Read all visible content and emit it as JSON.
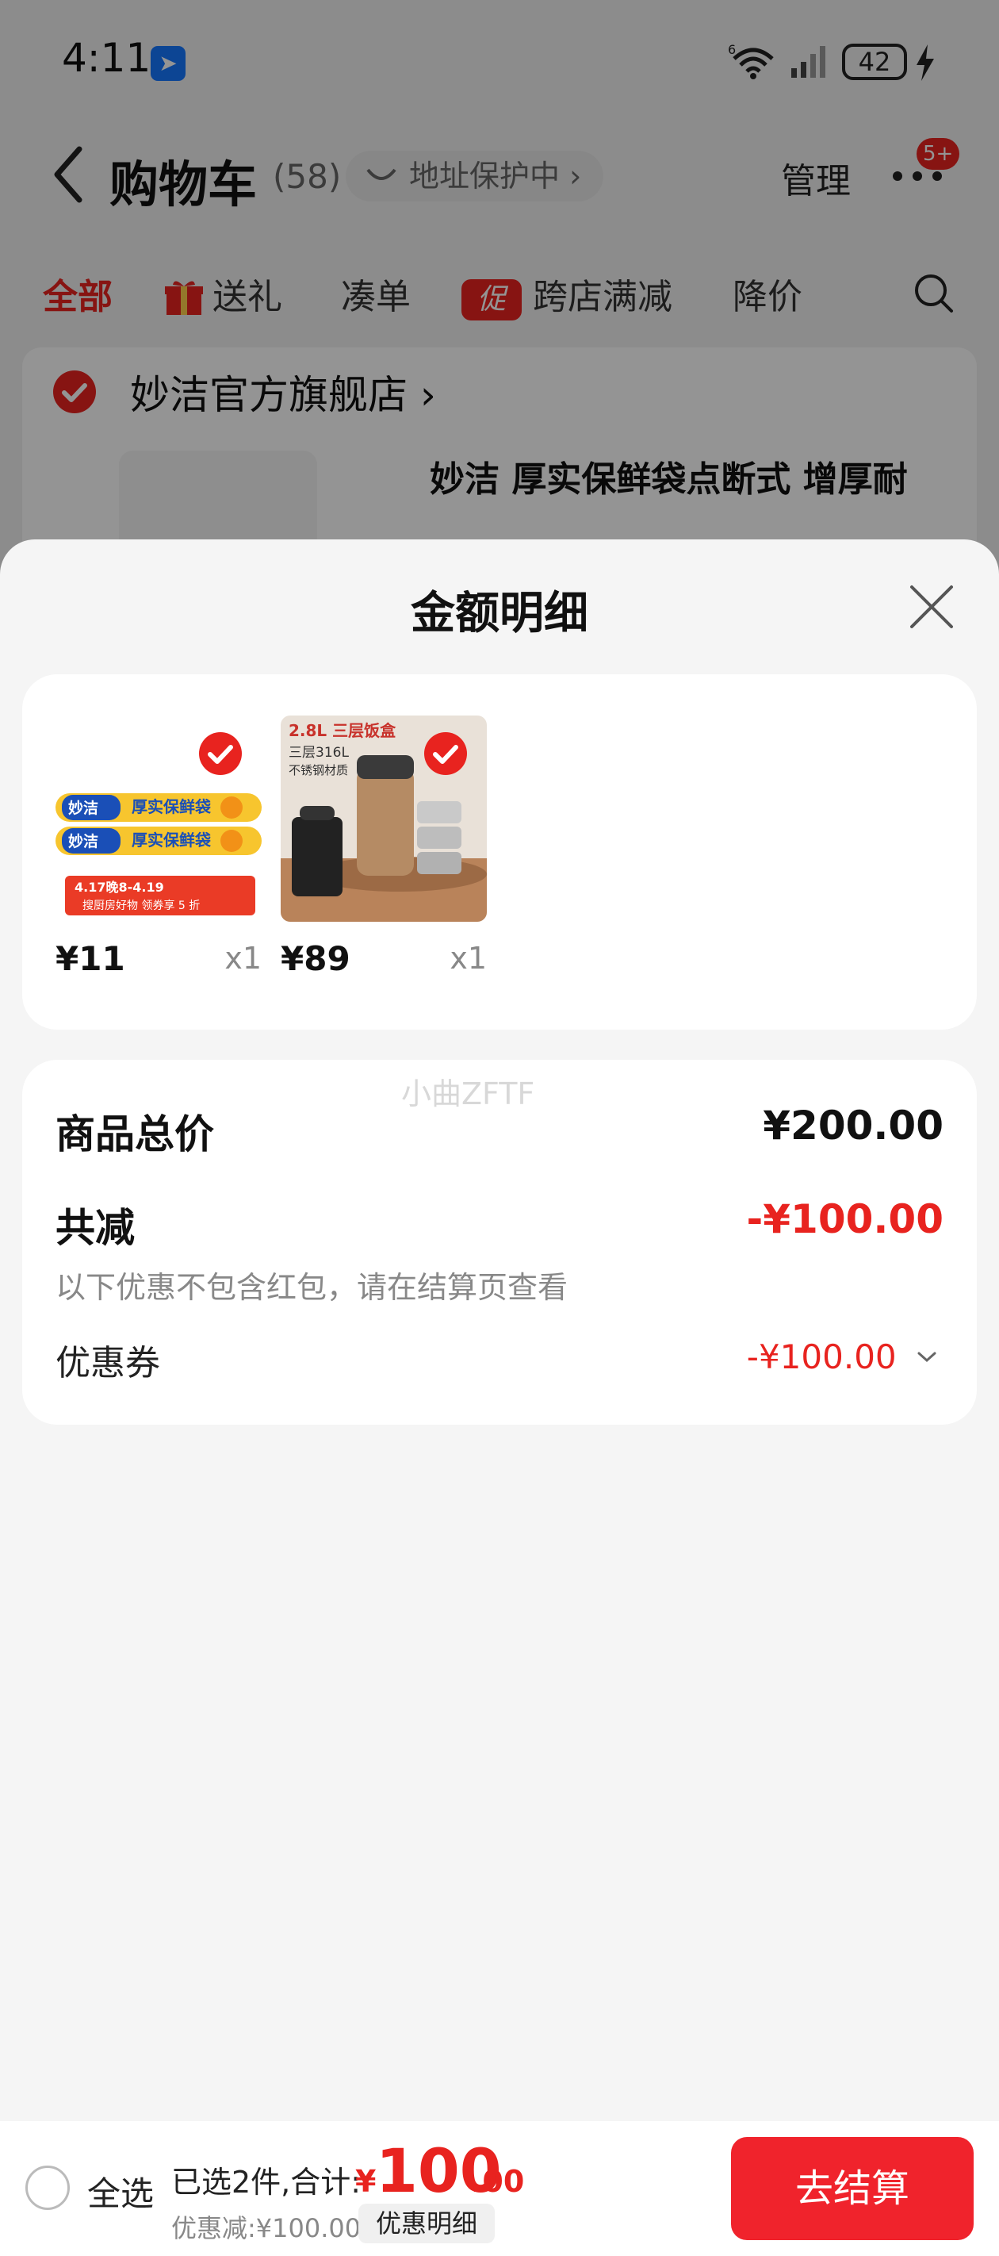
{
  "status_bar": {
    "time": "4:11",
    "network": "6",
    "battery": "42"
  },
  "header": {
    "title": "购物车",
    "count": "(58)",
    "address_protection": "地址保护中 ›",
    "manage": "管理",
    "more_badge": "5+"
  },
  "filter_tabs": [
    {
      "label": "全部"
    },
    {
      "label": "送礼"
    },
    {
      "label": "凑单"
    },
    {
      "label": "跨店满减",
      "badge": "促"
    },
    {
      "label": "降价"
    }
  ],
  "store": {
    "name": "妙洁官方旗舰店 ›",
    "product_title": "妙洁 厚实保鲜袋点断式 增厚耐"
  },
  "sheet": {
    "title": "金额明细",
    "items": [
      {
        "price": "¥11",
        "qty": "x1",
        "thumb_icon": "cling-wrap-bag-icon"
      },
      {
        "price": "¥89",
        "qty": "x1",
        "thumb_icon": "lunch-box-icon"
      }
    ],
    "watermark": "小曲ZFTF",
    "summary": {
      "total_label": "商品总价",
      "total_value": "¥200.00",
      "discount_label": "共减",
      "discount_value": "-¥100.00",
      "discount_note": "以下优惠不包含红包，请在结算页查看",
      "coupon_label": "优惠券",
      "coupon_value": "-¥100.00"
    }
  },
  "bottom_bar": {
    "select_all": "全选",
    "selected_summary": "已选2件,合计:",
    "total_currency": "¥",
    "total_int": "100",
    "total_dec": ".00",
    "discount_note": "优惠减:¥100.00",
    "detail_button": "优惠明细",
    "checkout": "去结算"
  },
  "colors": {
    "accent_red": "#e8231f",
    "checkout_red": "#f0232c",
    "overlay": "rgba(0,0,0,0.42)"
  },
  "item_thumb_texts": {
    "brand": "妙洁",
    "product": "厚实保鲜袋",
    "promo": "4.17晚8-4.19",
    "promo2": "搜厨房好物 领券享 5 折",
    "lunch_size": "2.8L 三层饭盒",
    "lunch_sub": "三层316L",
    "lunch_mat": "不锈钢材质"
  }
}
